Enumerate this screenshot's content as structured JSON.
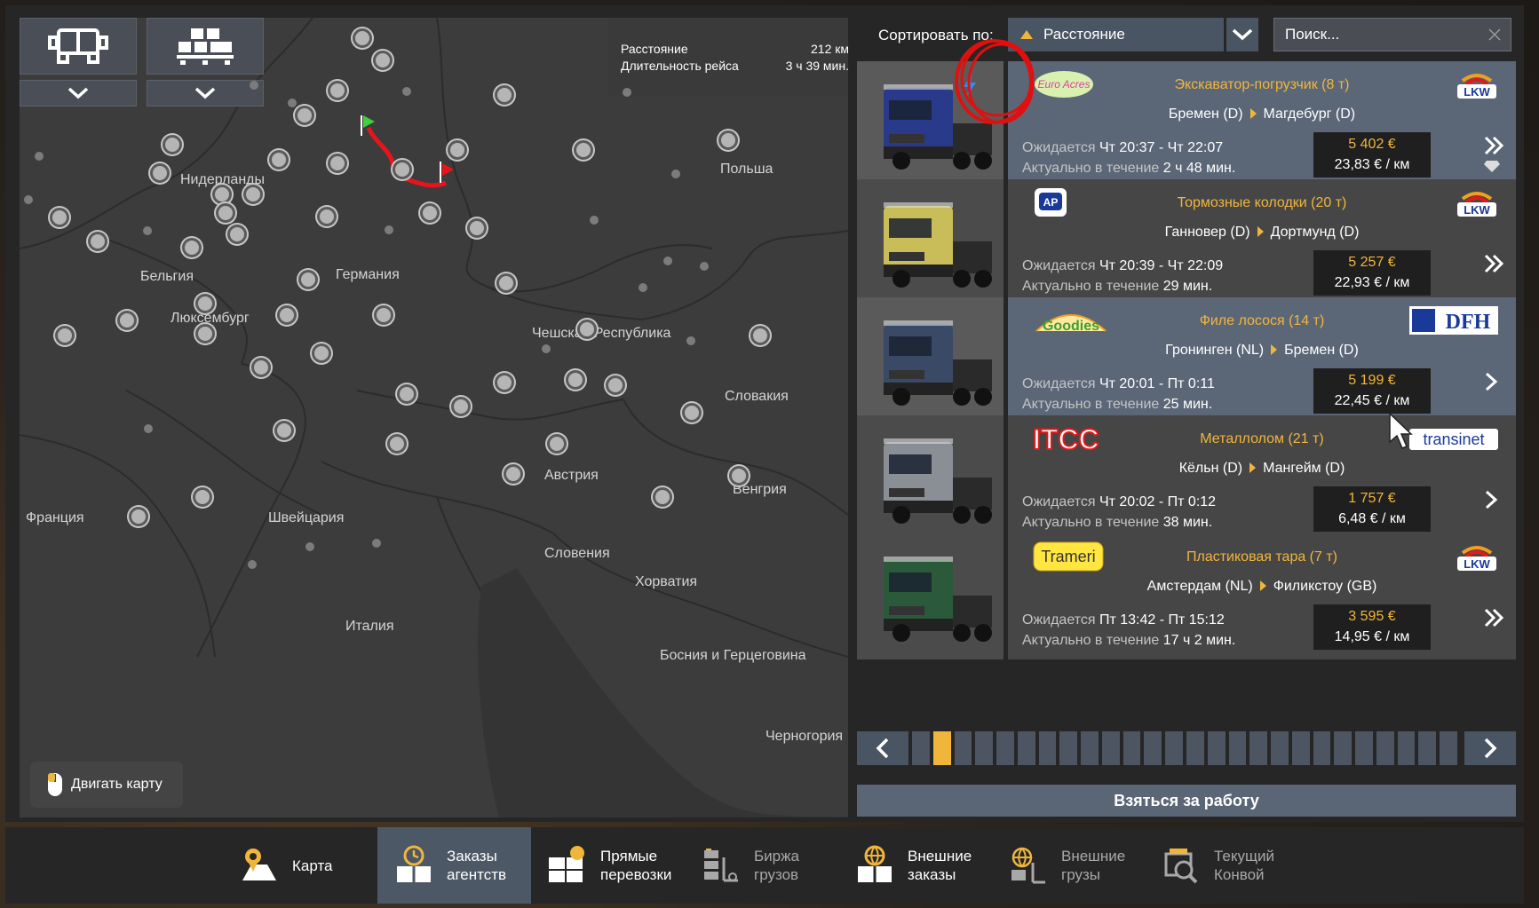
{
  "map": {
    "route_info": {
      "distance_label": "Расстояние",
      "distance_value": "212 км",
      "duration_label": "Длительность рейса",
      "duration_value": "3 ч 39 мин."
    },
    "countries": {
      "netherlands": "Нидерланды",
      "belgium": "Бельгия",
      "luxembourg": "Люксембург",
      "germany": "Германия",
      "poland": "Польша",
      "czech": "Чешская Республика",
      "slovakia": "Словакия",
      "austria": "Австрия",
      "hungary": "Венгрия",
      "france": "Франция",
      "switzerland": "Швейцария",
      "slovenia": "Словения",
      "croatia": "Хорватия",
      "italy": "Италия",
      "bosnia": "Босния и Герцеговина",
      "montenegro": "Черногория"
    },
    "move_map_label": "Двигать карту",
    "truck_filter_icon": "truck-filter-icon",
    "cargo_filter_icon": "cargo-filter-icon"
  },
  "sort": {
    "label": "Сортировать по:",
    "selected": "Расстояние"
  },
  "search": {
    "placeholder": "Поиск..."
  },
  "offers": [
    {
      "cargo": "Экскаватор-погрузчик (8 т)",
      "from": "Бремен (D)",
      "to": "Магдебург (D)",
      "expected_label": "Ожидается",
      "expected": "Чт 20:37 - Чт 22:07",
      "valid_label": "Актуально в течение",
      "valid": "2 ч 48 мин.",
      "price": "5 402 €",
      "per_km": "23,83 € / км",
      "company_left": "Euro Acres",
      "company_right": "LKW",
      "urgent": true,
      "truck_color": "#2a3a8a"
    },
    {
      "cargo": "Тормозные колодки (20 т)",
      "from": "Ганновер (D)",
      "to": "Дортмунд (D)",
      "expected_label": "Ожидается",
      "expected": "Чт 20:39 - Чт 22:09",
      "valid_label": "Актуально в течение",
      "valid": "29 мин.",
      "price": "5 257 €",
      "per_km": "22,93 € / км",
      "company_left": "AP",
      "company_right": "LKW",
      "urgent": false,
      "truck_color": "#c9bd5a"
    },
    {
      "cargo": "Филе лосося (14 т)",
      "from": "Гронинген (NL)",
      "to": "Бремен (D)",
      "expected_label": "Ожидается",
      "expected": "Чт 20:01 - Пт 0:11",
      "valid_label": "Актуально в течение",
      "valid": "25 мин.",
      "price": "5 199 €",
      "per_km": "22,45 € / км",
      "company_left": "Euro Goodies",
      "company_right": "DFH",
      "urgent": false,
      "truck_color": "#3a4a66"
    },
    {
      "cargo": "Металлолом (21 т)",
      "from": "Кёльн (D)",
      "to": "Мангейм (D)",
      "expected_label": "Ожидается",
      "expected": "Чт 20:02 - Пт 0:12",
      "valid_label": "Актуально в течение",
      "valid": "38 мин.",
      "price": "1 757 €",
      "per_km": "6,48 € / км",
      "company_left": "ITCC",
      "company_right": "transinet",
      "urgent": false,
      "truck_color": "#8a8f96"
    },
    {
      "cargo": "Пластиковая тара (7 т)",
      "from": "Амстердам (NL)",
      "to": "Филикстоу (GB)",
      "expected_label": "Ожидается",
      "expected": "Пт 13:42 - Пт 15:12",
      "valid_label": "Актуально в течение",
      "valid": "17 ч 2 мин.",
      "price": "3 595 €",
      "per_km": "14,95 € / км",
      "company_left": "Trameri",
      "company_right": "LKW",
      "urgent": false,
      "truck_color": "#2a5a3a"
    }
  ],
  "pager": {
    "total_pages": 26,
    "current_page": 2
  },
  "take_job_label": "Взяться за работу",
  "nav": [
    {
      "label": "Карта",
      "icon": "map-icon"
    },
    {
      "label": "Заказы агентств",
      "icon": "agency-orders-icon"
    },
    {
      "label": "Прямые перевозки",
      "icon": "direct-transport-icon"
    },
    {
      "label": "Биржа грузов",
      "icon": "freight-market-icon"
    },
    {
      "label": "Внешние заказы",
      "icon": "external-orders-icon"
    },
    {
      "label": "Внешние грузы",
      "icon": "external-cargo-icon"
    },
    {
      "label": "Текущий Конвой",
      "icon": "convoy-icon"
    }
  ],
  "colors": {
    "accent": "#f0b63c",
    "selected_row": "#5b6777",
    "nav_active": "#4c5866",
    "annotation": "#e01010"
  }
}
